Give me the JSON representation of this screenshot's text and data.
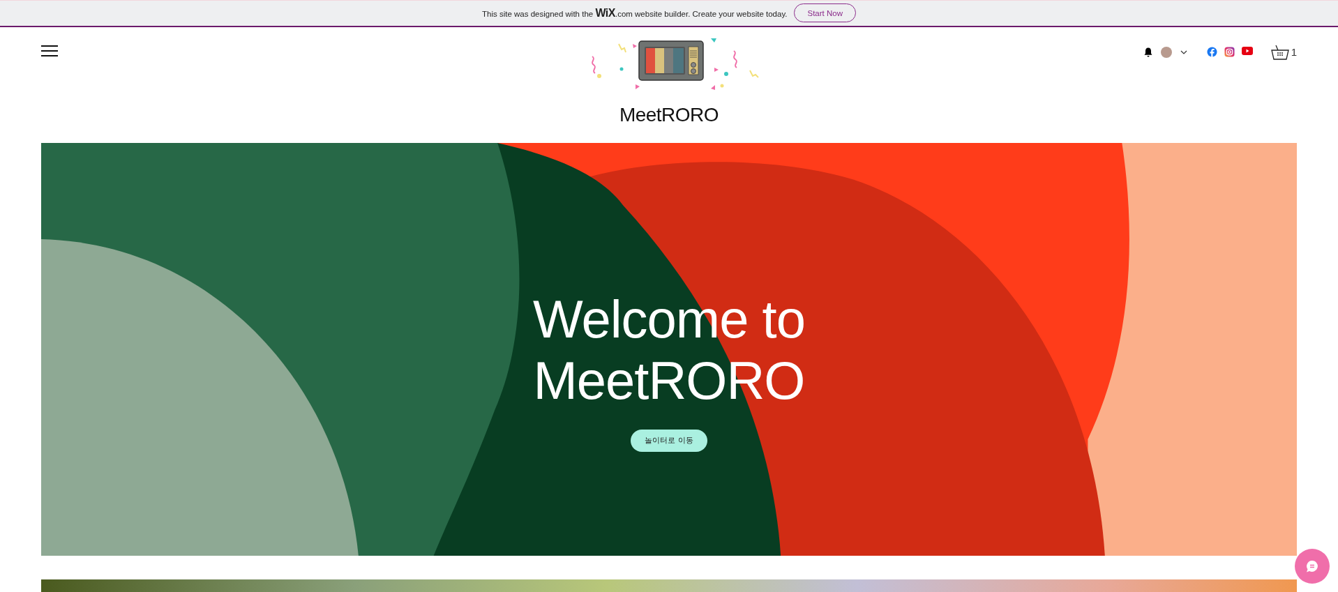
{
  "banner": {
    "text": "This site was designed with the **WiX**.com website builder. Create your website today.",
    "button": "Start Now"
  },
  "header": {
    "site_name": "MeetRORO",
    "cart_count": "1"
  },
  "hero": {
    "title_lines": [
      "Welcome to",
      "MeetRORO"
    ],
    "button": "놀이터로 이동"
  }
}
